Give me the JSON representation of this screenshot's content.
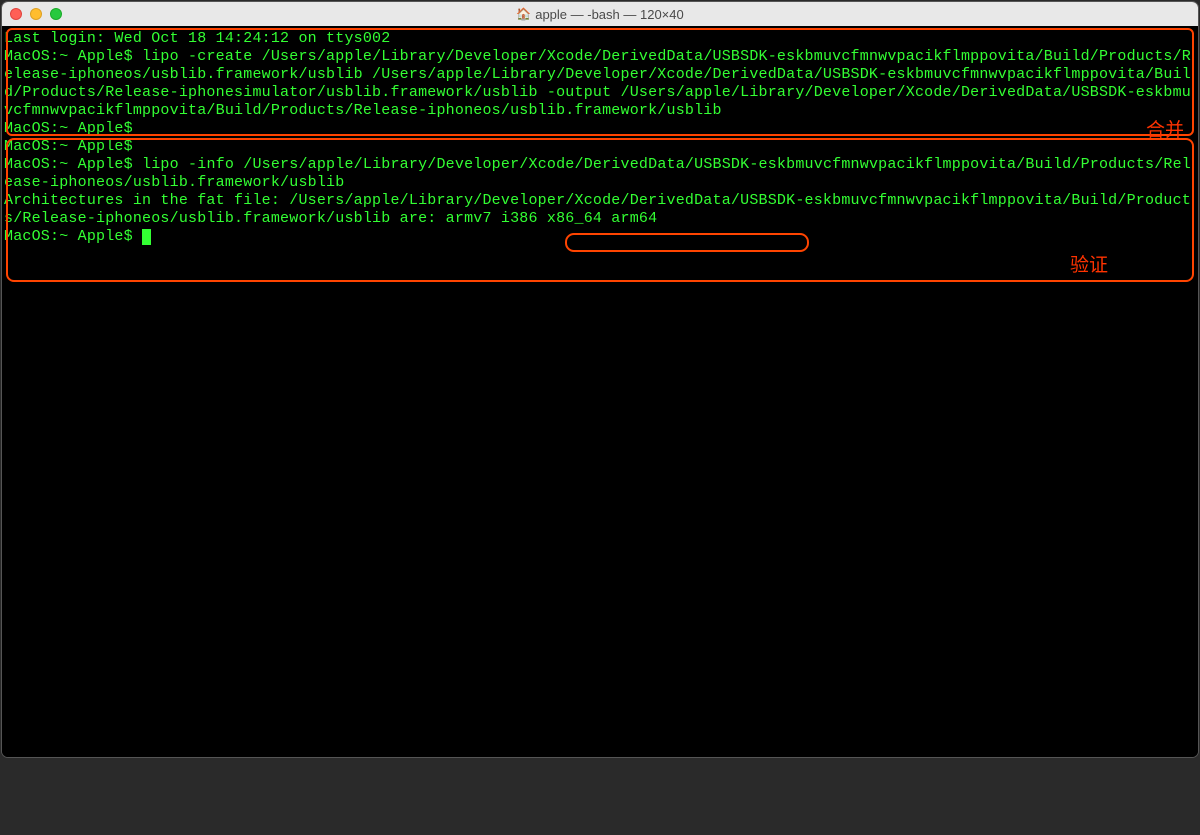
{
  "window": {
    "title": "apple — -bash — 120×40"
  },
  "terminal": {
    "line_login": "Last login: Wed Oct 18 14:24:12 on ttys002",
    "prompt": "MacOS:~ Apple$ ",
    "cmd_create": "lipo -create /Users/apple/Library/Developer/Xcode/DerivedData/USBSDK-eskbmuvcfmnwvpacikflmppovita/Build/Products/Release-iphoneos/usblib.framework/usblib /Users/apple/Library/Developer/Xcode/DerivedData/USBSDK-eskbmuvcfmnwvpacikflmppovita/Build/Products/Release-iphonesimulator/usblib.framework/usblib -output /Users/apple/Library/Developer/Xcode/DerivedData/USBSDK-eskbmuvcfmnwvpacikflmppovita/Build/Products/Release-iphoneos/usblib.framework/usblib",
    "cmd_info": "lipo -info /Users/apple/Library/Developer/Xcode/DerivedData/USBSDK-eskbmuvcfmnwvpacikflmppovita/Build/Products/Release-iphoneos/usblib.framework/usblib",
    "output_arch_prefix": "Architectures in the fat file: /Users/apple/Library/Developer/Xcode/DerivedData/USBSDK-eskbmuvcfmnwvpacikflmppovita/Build/Products/Release-iphoneos/usblib.framework/usblib are: ",
    "output_arch_list": "armv7 i386 x86_64 arm64"
  },
  "annotations": {
    "label_merge": "合并",
    "label_verify": "验证"
  }
}
